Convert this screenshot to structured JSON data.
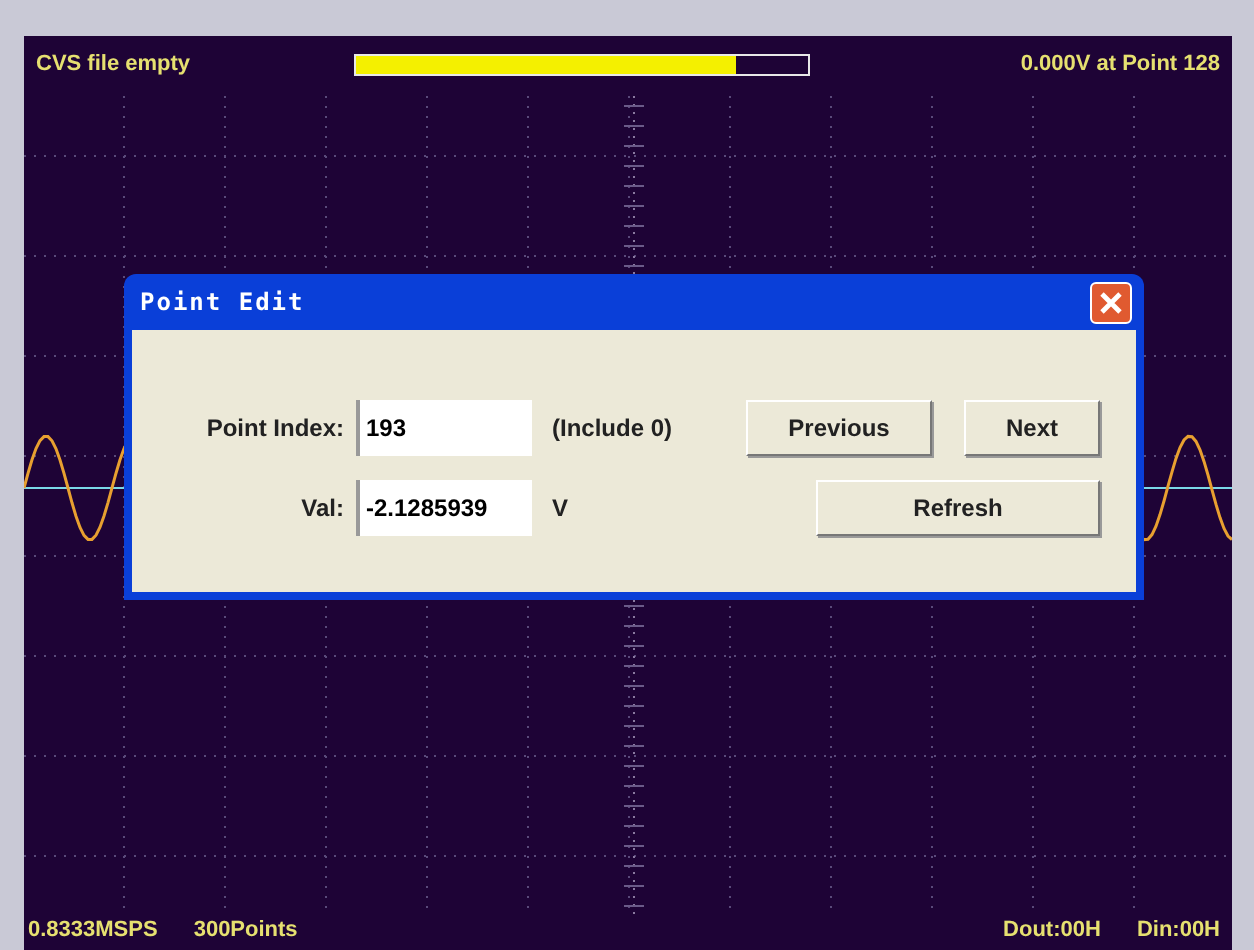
{
  "header": {
    "file_status": "CVS file empty",
    "progress": {
      "level": 0.84
    },
    "reading": "0.000V at Point 128"
  },
  "dialog": {
    "title": "Point Edit",
    "fields": [
      {
        "label": "Point Index:",
        "value": "193",
        "note": "(Include 0)"
      },
      {
        "label": "Val:",
        "value": "-2.1285939",
        "note": "V"
      }
    ],
    "buttons": [
      "Previous",
      "Next",
      "Refresh"
    ]
  },
  "footer": {
    "left": [
      "0.8333MSPS",
      "300Points"
    ],
    "right": [
      "Dout:00H",
      "Din:00H"
    ]
  }
}
